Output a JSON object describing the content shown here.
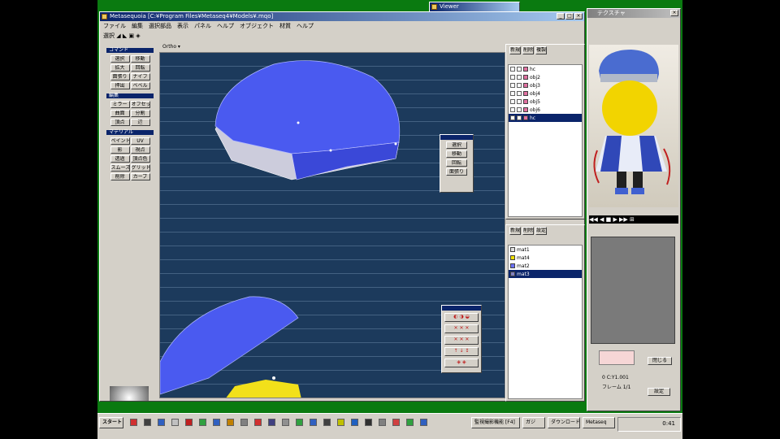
{
  "main_window": {
    "title": "Metasequoia [C:¥Program Files¥Metaseq4¥Models¥.mqo]",
    "menu": [
      "ファイル",
      "編集",
      "選択部品",
      "表示",
      "パネル",
      "ヘルプ",
      "オブジェクト",
      "材質",
      "ヘルプ"
    ],
    "toolbar_label": "選択 ◢ ◣ ▣ ◈",
    "view_label": "Ortho ▾"
  },
  "left_panel": {
    "sections": [
      {
        "head": "コマンド",
        "buttons": [
          "選択",
          "移動",
          "拡大",
          "回転",
          "面張り",
          "ナイフ",
          "押出",
          "ベベル"
        ]
      },
      {
        "head": "編集",
        "buttons": [
          "ミラー",
          "オフセット",
          "曲面",
          "分割",
          "頂点",
          "辺"
        ]
      },
      {
        "head": "マテリアル",
        "buttons": [
          "ペイント",
          "UV",
          "影",
          "視点",
          "透過",
          "頂点色",
          "スムーズ",
          "グリッド",
          "削除",
          "カーブ"
        ]
      }
    ]
  },
  "float_cmd": {
    "buttons": [
      "選択",
      "移動",
      "回転",
      "面張り"
    ]
  },
  "float_nav": {
    "rows": [
      "◐ ◑ ◒",
      "✕ ✕ ✕",
      "✕ ✕ ✕",
      "↑ ↓ ↕",
      "◈ ◈"
    ]
  },
  "object_panel": {
    "tabs": [
      "新規",
      "削除",
      "複製"
    ],
    "rows": [
      {
        "name": "hc"
      },
      {
        "name": "obj2"
      },
      {
        "name": "obj3"
      },
      {
        "name": "obj4"
      },
      {
        "name": "obj5"
      },
      {
        "name": "obj6"
      },
      {
        "name": "hc",
        "selected": true
      }
    ]
  },
  "material_panel": {
    "tabs": [
      "新規",
      "削除",
      "設定"
    ],
    "rows": [
      {
        "name": "mat1",
        "color": "#e0e0e0"
      },
      {
        "name": "mat4",
        "color": "#f0e000"
      },
      {
        "name": "mat2",
        "color": "#6a70ff"
      },
      {
        "name": "mat3",
        "color": "#8080c0",
        "selected": true
      }
    ]
  },
  "preview_window": {
    "title": "テクスチャ",
    "controls": "◀◀ ◀ ■ ▶ ▶▶ ⊞",
    "footer_btn": "閉じる",
    "status1": "0  C:Y1.001",
    "status2": "フレーム 1/1",
    "status3": "設定"
  },
  "taskbar": {
    "start": "スタート",
    "tasks": [
      "監視撮影機能 [F4]",
      "ガジ",
      "ダウンロード",
      "Metaseq"
    ],
    "time": "0:41"
  },
  "top_window_title": "Viewer"
}
